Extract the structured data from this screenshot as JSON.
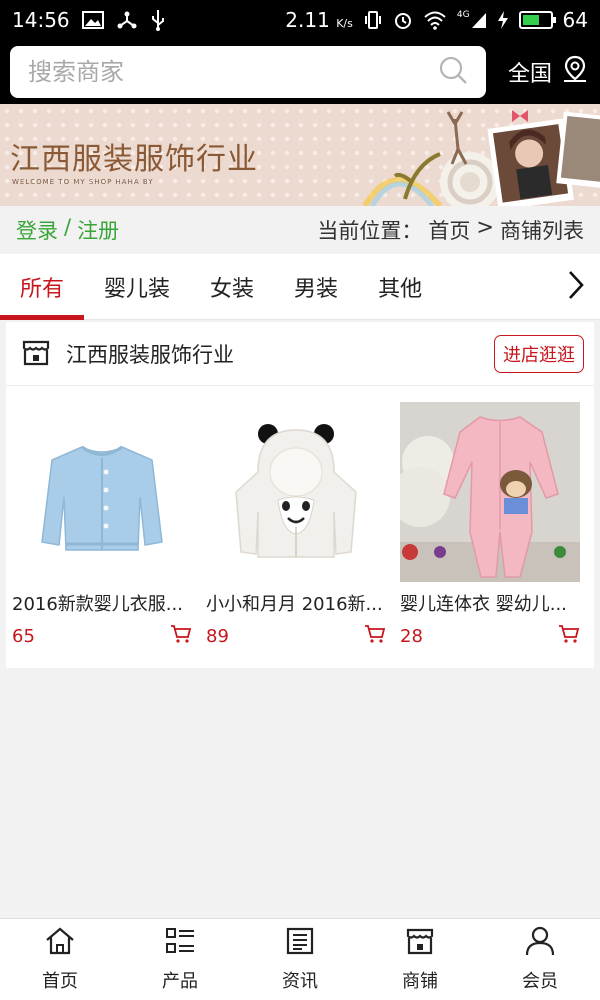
{
  "status_bar": {
    "time": "14:56",
    "network_speed": "2.11",
    "speed_unit": "K/s",
    "signal_type": "4G",
    "battery": "64"
  },
  "search": {
    "placeholder": "搜索商家",
    "region_label": "全国"
  },
  "banner": {
    "title": "江西服装服饰行业",
    "subtitle": "WELCOME TO MY SHOP HAHA BY"
  },
  "location_bar": {
    "login_label": "登录",
    "separator": "/",
    "register_label": "注册",
    "location_prefix": "当前位置：",
    "crumb_home": "首页",
    "crumb_sep": ">",
    "crumb_current": "商铺列表"
  },
  "tabs": [
    {
      "label": "所有",
      "active": true
    },
    {
      "label": "婴儿装",
      "active": false
    },
    {
      "label": "女装",
      "active": false
    },
    {
      "label": "男装",
      "active": false
    },
    {
      "label": "其他",
      "active": false
    }
  ],
  "shop": {
    "name": "江西服装服饰行业",
    "visit_label": "进店逛逛",
    "products": [
      {
        "name": "2016新款婴儿衣服...",
        "price": "65",
        "image": "blue-cardigan"
      },
      {
        "name": "小小和月月 2016新...",
        "price": "89",
        "image": "white-bear-hoodie"
      },
      {
        "name": "婴儿连体衣 婴幼儿...",
        "price": "28",
        "image": "pink-romper"
      }
    ]
  },
  "bottom_nav": [
    {
      "label": "首页",
      "icon": "home-icon"
    },
    {
      "label": "产品",
      "icon": "list-icon"
    },
    {
      "label": "资讯",
      "icon": "news-icon"
    },
    {
      "label": "商铺",
      "icon": "store-icon"
    },
    {
      "label": "会员",
      "icon": "user-icon"
    }
  ],
  "colors": {
    "accent": "#c8161d",
    "auth_green": "#3aa63a",
    "status_bar": "#000000",
    "battery_fill": "#35d04a"
  }
}
